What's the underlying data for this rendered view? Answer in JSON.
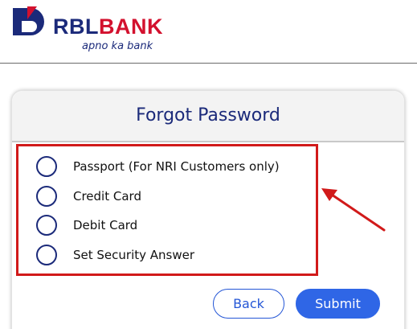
{
  "brand": {
    "name_part1": "RBL",
    "name_part2": "BANK",
    "tagline": "apno ka bank",
    "colors": {
      "navy": "#1b2a7a",
      "red": "#d3112e"
    }
  },
  "dialog": {
    "title": "Forgot Password",
    "options": [
      {
        "label": "Passport (For NRI Customers only)",
        "selected": false
      },
      {
        "label": "Credit Card",
        "selected": false
      },
      {
        "label": "Debit Card",
        "selected": false
      },
      {
        "label": "Set Security Answer",
        "selected": false
      }
    ],
    "buttons": {
      "back_label": "Back",
      "submit_label": "Submit"
    }
  },
  "annotation": {
    "highlight_color": "#d11a1a",
    "icon": "arrow-pointer-icon"
  }
}
